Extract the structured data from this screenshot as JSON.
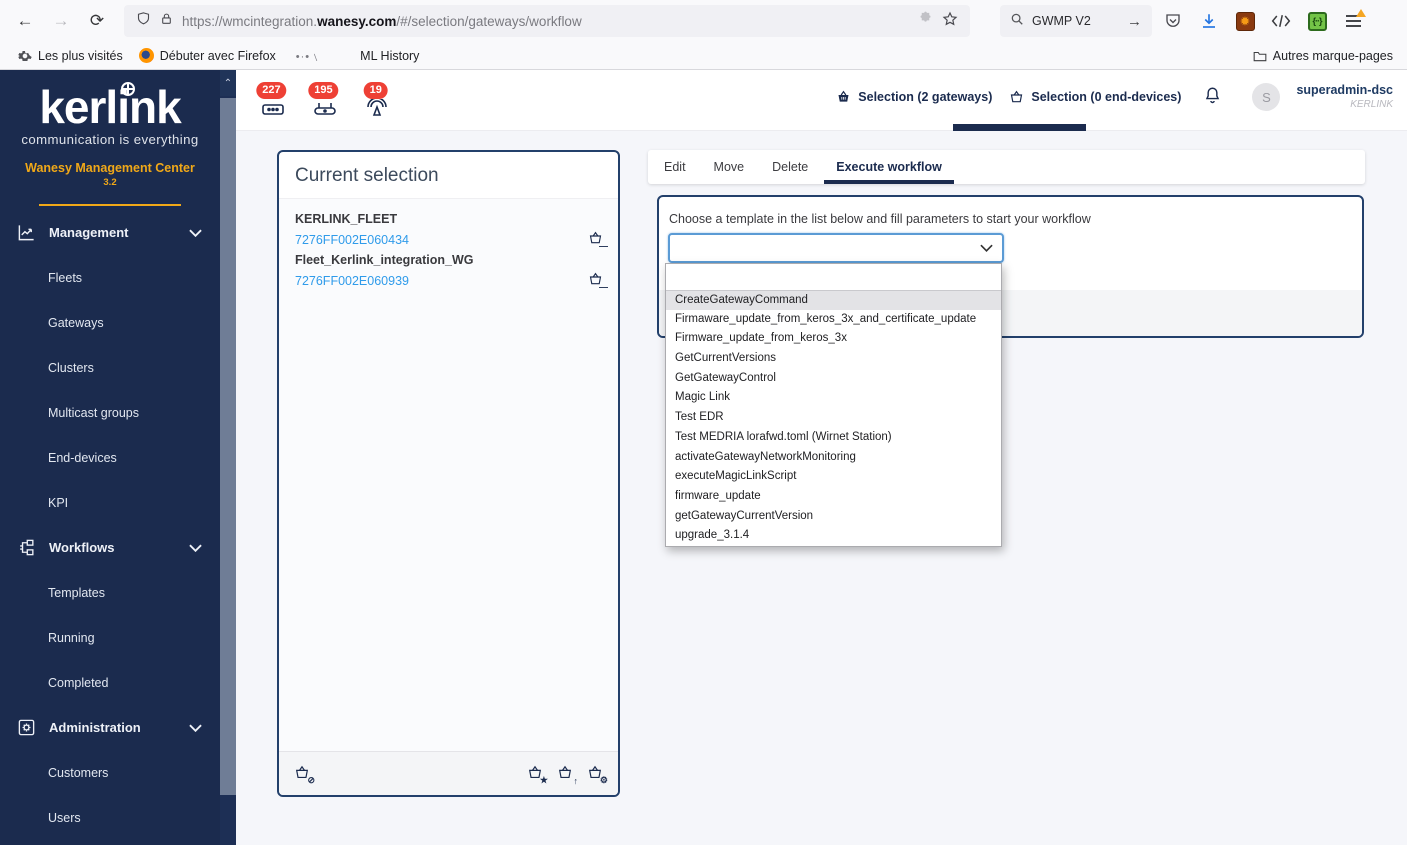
{
  "browser": {
    "back": "←",
    "forward": "→",
    "reload": "⟳",
    "url": {
      "prefix": "https://wmcintegration.",
      "domain": "wanesy.com",
      "path": "/#/selection/gateways/workflow"
    },
    "search": {
      "value": "GWMP V2"
    },
    "bookmarks": {
      "most_visited": "Les plus visités",
      "get_started": "Débuter avec Firefox",
      "doodle": "•·•﹨",
      "ml_history": "ML History",
      "other_bookmarks": "Autres marque-pages"
    },
    "ext_green_glyph": "{··}"
  },
  "colors": {
    "sidebar_navy": "#1b2b4e",
    "badge_red": "#ee4035",
    "link_blue": "#2f9bea",
    "brand_orange": "#f0a818"
  },
  "sidebar": {
    "logo_text": "kerlink",
    "tagline": "communication is everything",
    "app_title": "Wanesy Management Center",
    "version": "3.2",
    "sections": [
      {
        "label": "Management",
        "items": [
          "Fleets",
          "Gateways",
          "Clusters",
          "Multicast groups",
          "End-devices",
          "KPI"
        ]
      },
      {
        "label": "Workflows",
        "items": [
          "Templates",
          "Running",
          "Completed"
        ]
      },
      {
        "label": "Administration",
        "items": [
          "Customers",
          "Users"
        ]
      }
    ]
  },
  "header": {
    "counters": [
      {
        "count": "227",
        "icon": "modem-icon"
      },
      {
        "count": "195",
        "icon": "gateway-icon"
      },
      {
        "count": "19",
        "icon": "antenna-icon"
      }
    ],
    "gateway_selection_label": "Selection (2 gateways)",
    "enddevice_selection_label": "Selection (0 end-devices)",
    "user": {
      "initial": "S",
      "name": "superadmin-dsc",
      "org": "KERLINK"
    }
  },
  "selection_panel": {
    "title": "Current selection",
    "entries": [
      {
        "fleet": "KERLINK_FLEET",
        "gateway": "7276FF002E060434"
      },
      {
        "fleet": "Fleet_Kerlink_integration_WG",
        "gateway": "7276FF002E060939"
      }
    ]
  },
  "action_tabs": {
    "items": [
      "Edit",
      "Move",
      "Delete",
      "Execute workflow"
    ],
    "active": "Execute workflow"
  },
  "workflow_panel": {
    "instruction": "Choose a template in the list below and fill parameters to start your workflow",
    "select_value": "",
    "highlighted": "CreateGatewayCommand",
    "templates": [
      "CreateGatewayCommand",
      "Firmaware_update_from_keros_3x_and_certificate_update",
      "Firmware_update_from_keros_3x",
      "GetCurrentVersions",
      "GetGatewayControl",
      "Magic Link",
      "Test EDR",
      "Test MEDRIA lorafwd.toml (Wirnet Station)",
      "activateGatewayNetworkMonitoring",
      "executeMagicLinkScript",
      "firmware_update",
      "getGatewayCurrentVersion",
      "upgrade_3.1.4"
    ]
  }
}
